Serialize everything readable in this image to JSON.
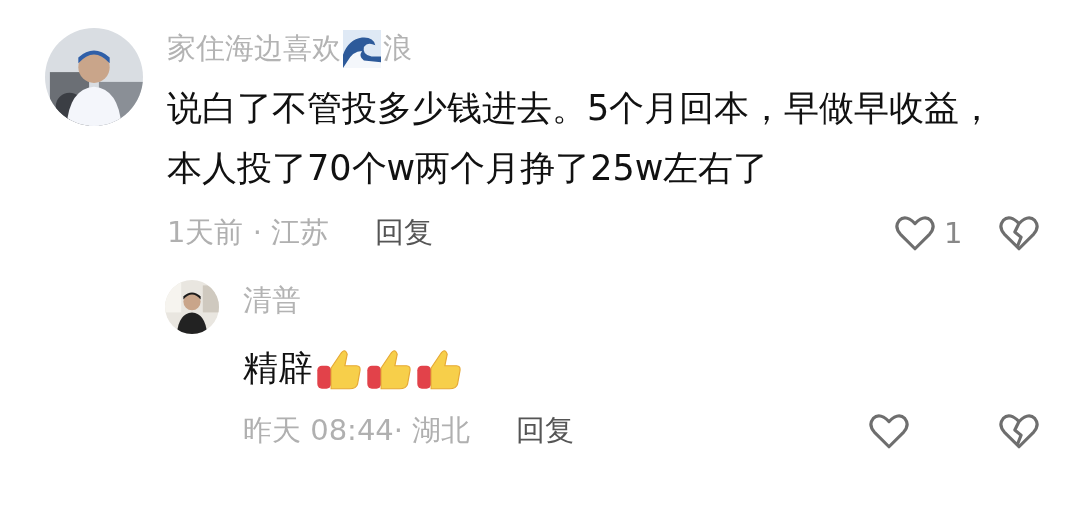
{
  "comments": [
    {
      "avatar": {
        "kind": "picture"
      },
      "name": [
        {
          "kind": "text",
          "text": "家住海边喜欢"
        },
        {
          "kind": "wave"
        },
        {
          "kind": "text",
          "text": "浪"
        }
      ],
      "content": [
        {
          "kind": "text",
          "text": "说白了不管投多少钱进去。5个月回本，早做早收益，本人投了70个w两个月挣了25w左右了"
        }
      ],
      "time": "1天前 · 江苏",
      "reply_label": "回复",
      "like_count": "1",
      "replies": [
        {
          "avatar": {
            "kind": "picture"
          },
          "name": [
            {
              "kind": "text",
              "text": "清普"
            }
          ],
          "content": [
            {
              "kind": "text",
              "text": "精辟"
            },
            {
              "kind": "thumbs-up"
            },
            {
              "kind": "thumbs-up"
            },
            {
              "kind": "thumbs-up"
            }
          ],
          "time": "昨天 08:44· 湖北",
          "reply_label": "回复"
        }
      ]
    }
  ]
}
